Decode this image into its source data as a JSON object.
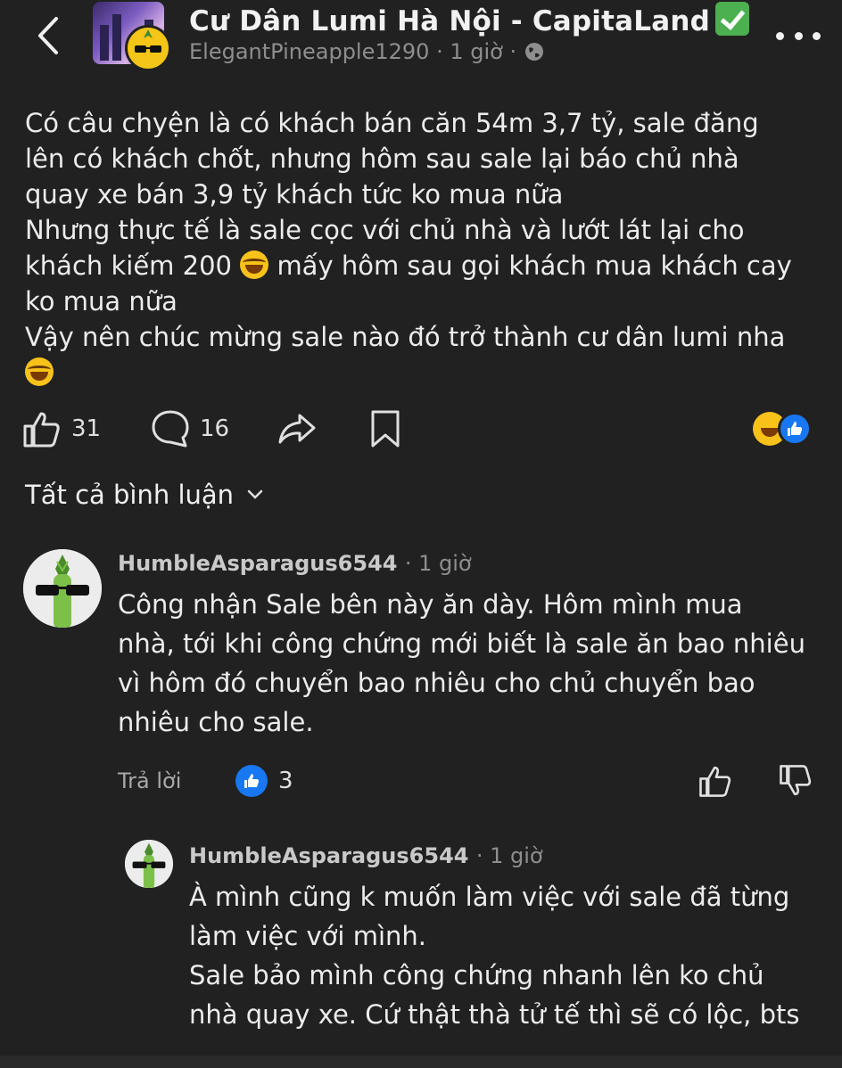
{
  "header": {
    "group_name": "Cư Dân Lumi Hà Nội - CapitaLand",
    "author": "ElegantPineapple1290",
    "time": "1 giờ",
    "separator": "·"
  },
  "post": {
    "lines": [
      "Có câu chyện là có khách bán căn 54m 3,7 tỷ, sale đăng",
      "lên có khách chốt, nhưng hôm sau sale lại báo chủ nhà",
      "quay xe bán 3,9 tỷ khách tức ko mua nữa",
      "Nhưng thực tế là sale cọc với chủ nhà và lướt lát lại cho",
      "khách kiếm 200",
      "mấy hôm sau gọi khách mua khách cay",
      "ko mua nữa",
      "Vậy nên chúc mừng sale nào đó trở thành cư dân lumi nha"
    ]
  },
  "actions": {
    "likes": "31",
    "comments": "16"
  },
  "comments_section": {
    "title": "Tất cả bình luận"
  },
  "comments": [
    {
      "author": "HumbleAsparagus6544",
      "time": "· 1 giờ",
      "lines": [
        "Công nhận Sale bên này ăn dày. Hôm mình mua",
        "nhà, tới khi công chứng mới biết là sale ăn bao nhiêu",
        "vì hôm đó chuyển bao nhiêu cho chủ chuyển bao",
        "nhiêu cho sale."
      ],
      "reply_label": "Trả lời",
      "like_count": "3"
    },
    {
      "author": "HumbleAsparagus6544",
      "time": "· 1 giờ",
      "lines": [
        "À mình cũng k muốn làm việc với sale đã từng",
        "làm việc với mình.",
        "Sale bảo mình công chứng nhanh lên ko chủ",
        "nhà quay xe. Cứ thật thà tử tế thì sẽ có lộc, bts"
      ]
    }
  ],
  "colors": {
    "background": "#212121",
    "like_blue": "#1877f2",
    "verified_green": "#4caf50"
  },
  "icons": [
    "back-chevron-icon",
    "verified-check-icon",
    "globe-icon",
    "more-dots-icon",
    "thumbs-up-icon",
    "comment-bubble-icon",
    "share-arrow-icon",
    "bookmark-icon",
    "haha-reaction-icon",
    "like-reaction-icon",
    "chevron-down-icon",
    "downvote-icon"
  ]
}
